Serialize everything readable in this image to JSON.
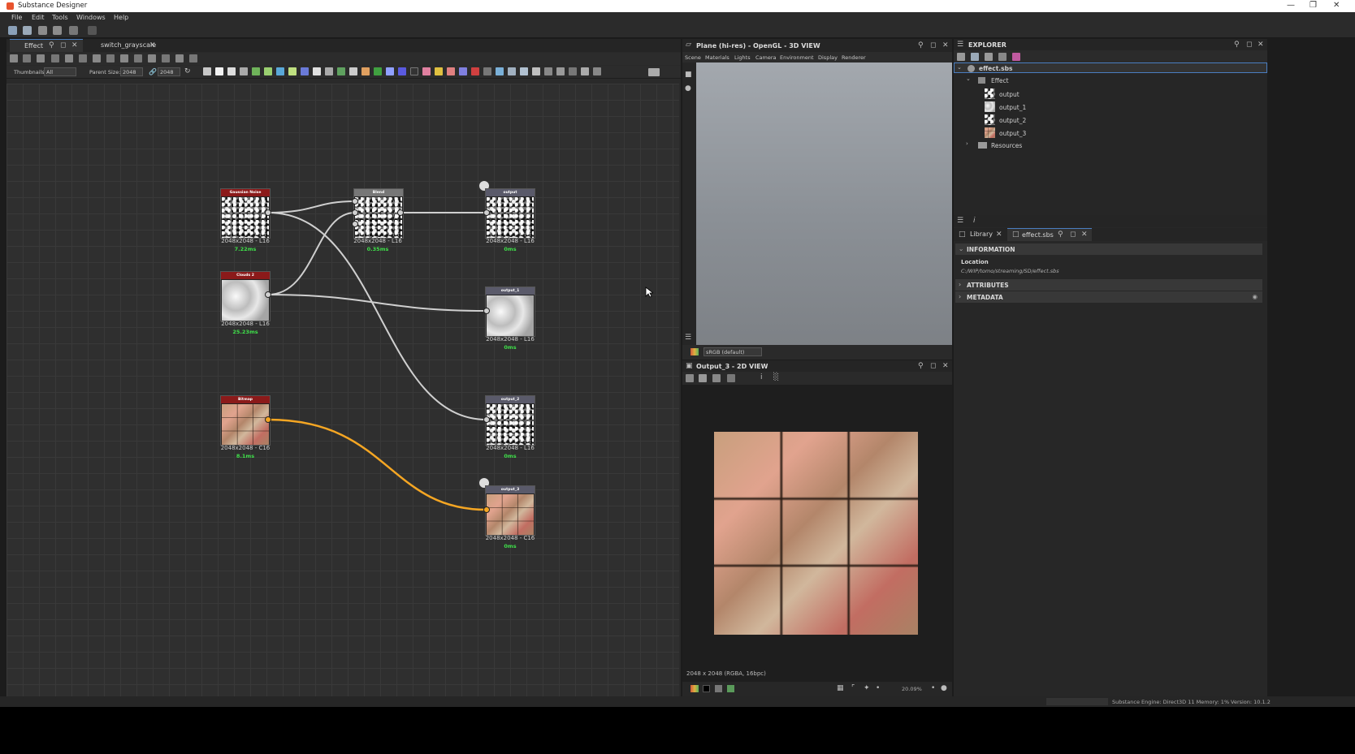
{
  "app": {
    "title": "Substance Designer"
  },
  "menu": [
    "File",
    "Edit",
    "Tools",
    "Windows",
    "Help"
  ],
  "graph_tabs": [
    {
      "label": "Effect"
    },
    {
      "label": "switch_grayscale"
    }
  ],
  "graph_toolbar": {
    "thumbnails_label": "Thumbnails:",
    "thumbnails_value": "All",
    "parent_size_label": "Parent Size:",
    "parent_size_value": "2048",
    "size_value": "2048"
  },
  "nodes": {
    "gaussian": {
      "title": "Gaussian Noise",
      "res": "2048x2048 - L16",
      "time": "7.22ms"
    },
    "clouds": {
      "title": "Clouds 2",
      "res": "2048x2048 - L16",
      "time": "25.23ms"
    },
    "bitmap": {
      "title": "Bitmap",
      "res": "2048x2048 - C16",
      "time": "8.1ms"
    },
    "blend": {
      "title": "Blend",
      "res": "2048x2048 - L16",
      "time": "0.35ms"
    },
    "output": {
      "title": "output",
      "res": "2048x2048 - L16",
      "time": "0ms"
    },
    "output_1": {
      "title": "output_1",
      "res": "2048x2048 - L16",
      "time": "0ms"
    },
    "output_2": {
      "title": "output_2",
      "res": "2048x2048 - L16",
      "time": "0ms"
    },
    "output_3": {
      "title": "output_3",
      "res": "2048x2048 - C16",
      "time": "0ms"
    }
  },
  "view3d": {
    "title": "Plane (hi-res) - OpenGL - 3D VIEW",
    "menu": [
      "Scene",
      "Materials",
      "Lights",
      "Camera",
      "Environment",
      "Display",
      "Renderer"
    ],
    "colorspace": "sRGB (default)"
  },
  "view2d": {
    "title": "Output_3 - 2D VIEW",
    "info": "2048 x 2048 (RGBA, 16bpc)",
    "zoom": "20.09%"
  },
  "explorer": {
    "title": "EXPLORER",
    "package": "effect.sbs",
    "graph": "Effect",
    "outputs": [
      "output",
      "output_1",
      "output_2",
      "output_3"
    ],
    "resources": "Resources"
  },
  "props": {
    "tabs": [
      {
        "label": "Library"
      },
      {
        "label": "effect.sbs"
      }
    ],
    "sections": [
      "INFORMATION",
      "ATTRIBUTES",
      "METADATA"
    ],
    "location_label": "Location",
    "location_value": "C:/WIP/tomo/streaming/SD/effect.sbs"
  },
  "status": {
    "engine": "Substance Engine: Direct3D 11  Memory: 1%",
    "version": "Version: 10.1.2"
  },
  "colors": {
    "accent": "#4a7ec0",
    "node_red": "#8b1a1a",
    "node_gray": "#5a5a6a",
    "wire_selected": "#f5a623",
    "time_green": "#3fe04a"
  }
}
